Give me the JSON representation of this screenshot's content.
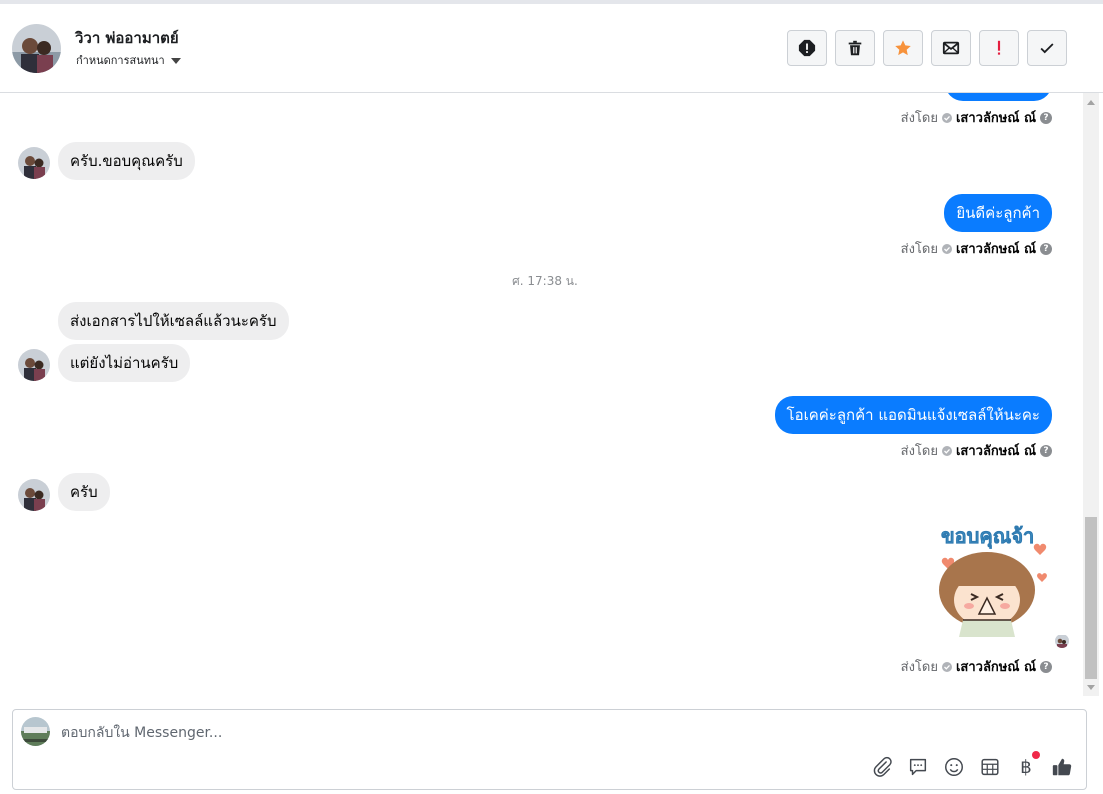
{
  "header": {
    "contact_name": "วิวา พ่ออามาตย์",
    "subtitle": "กำหนดการสนทนา",
    "actions": [
      {
        "name": "report-button",
        "icon": "exclamation-circle-icon"
      },
      {
        "name": "delete-button",
        "icon": "trash-icon"
      },
      {
        "name": "star-button",
        "icon": "star-icon"
      },
      {
        "name": "mark-unread-button",
        "icon": "envelope-icon"
      },
      {
        "name": "spam-button",
        "icon": "exclamation-icon"
      },
      {
        "name": "done-button",
        "icon": "check-icon"
      }
    ]
  },
  "messages": {
    "sent_by_label": "ส่งโดย",
    "sender_name": "เสาวลักษณ์ ณ์",
    "help_mark": "?",
    "incoming_1": "ครับ.ขอบคุณครับ",
    "outgoing_1": "ยินดีค่ะลูกค้า",
    "timestamp": "ศ. 17:38 น.",
    "incoming_2": "ส่งเอกสารไปให้เซลล์แล้วนะครับ",
    "incoming_3": "แต่ยังไม่อ่านครับ",
    "outgoing_2": "โอเคค่ะลูกค้า แอดมินแจ้งเซลล์ให้นะคะ",
    "incoming_4": "ครับ",
    "sticker_text": "ขอบคุณจ้า"
  },
  "composer": {
    "placeholder": "ตอบกลับใน Messenger...",
    "baht_symbol": "฿"
  },
  "colors": {
    "outgoing_bubble": "#0a7cff",
    "incoming_bubble": "#eeeeef",
    "star": "#f7923b",
    "alert_red": "#e41e3f"
  }
}
